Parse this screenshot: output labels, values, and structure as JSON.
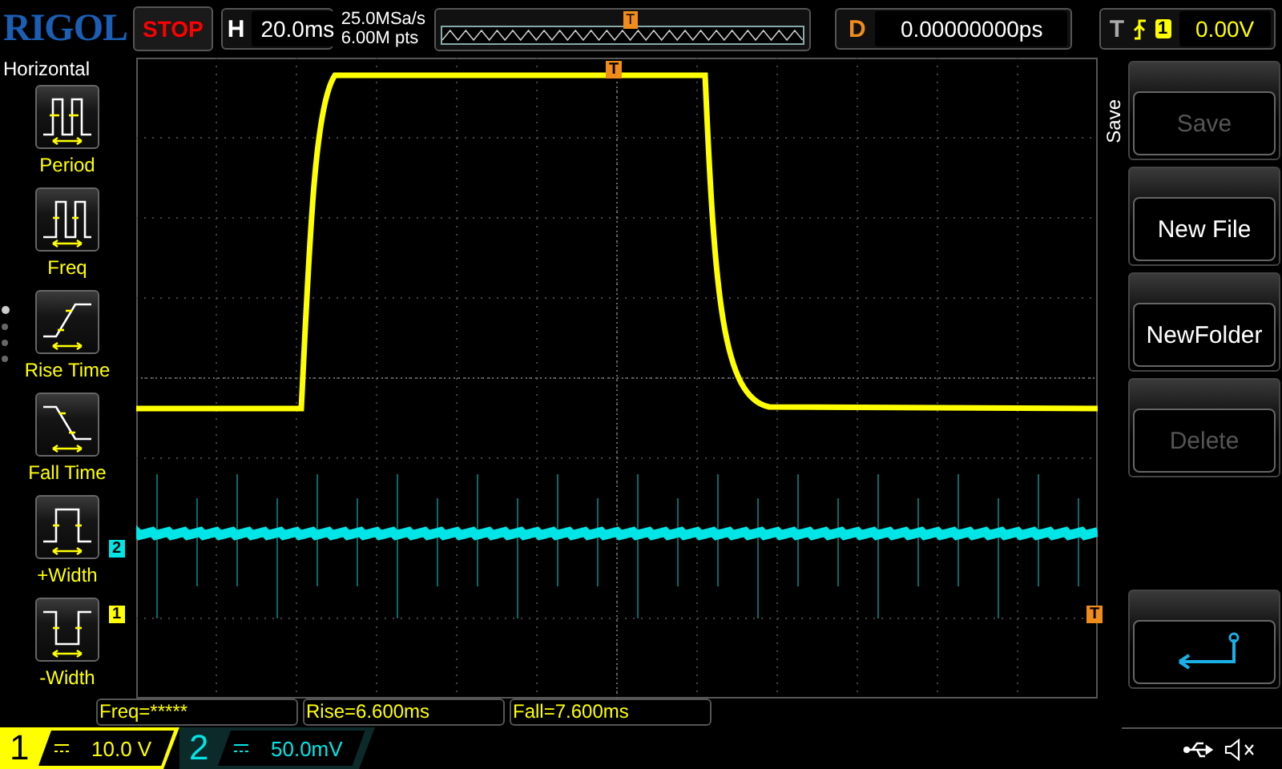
{
  "brand": "RIGOL",
  "run_state": "STOP",
  "horizontal": {
    "label": "H",
    "value": "20.0ms"
  },
  "acquisition": {
    "sample_rate": "25.0MSa/s",
    "memory_depth": "6.00M pts"
  },
  "delay": {
    "label": "D",
    "value": "0.00000000ps"
  },
  "trigger": {
    "label": "T",
    "source": "1",
    "level": "0.00V"
  },
  "left_menu": {
    "title": "Horizontal",
    "items": [
      {
        "kind": "period",
        "label": "Period"
      },
      {
        "kind": "freq",
        "label": "Freq"
      },
      {
        "kind": "rise",
        "label": "Rise Time"
      },
      {
        "kind": "fall",
        "label": "Fall Time"
      },
      {
        "kind": "pwidth",
        "label": "+Width"
      },
      {
        "kind": "nwidth",
        "label": "-Width"
      }
    ],
    "pages": [
      {
        "selected": true
      },
      {
        "selected": false
      },
      {
        "selected": false
      },
      {
        "selected": false
      }
    ]
  },
  "memory_overview": {
    "trigger_marker": "T"
  },
  "markers": {
    "channel_2": "2",
    "channel_1": "1",
    "trigger_level": "T",
    "trigger_position": "T"
  },
  "right_menu": {
    "title": "Save",
    "buttons": [
      {
        "kind": "text",
        "label": "Save",
        "disabled": true
      },
      {
        "kind": "text",
        "label": "New File",
        "disabled": false
      },
      {
        "kind": "text",
        "label": "NewFolder",
        "disabled": false
      },
      {
        "kind": "text",
        "label": "Delete",
        "disabled": true
      },
      {
        "kind": "back",
        "disabled": false
      }
    ]
  },
  "measurements": [
    "Freq=*****",
    "Rise=6.600ms",
    "Fall=7.600ms"
  ],
  "channels": [
    {
      "number": "1",
      "scale": "10.0 V",
      "color": "#ffff00",
      "selected": true
    },
    {
      "number": "2",
      "scale": "50.0mV",
      "color": "#00e5e5",
      "selected": false
    }
  ]
}
